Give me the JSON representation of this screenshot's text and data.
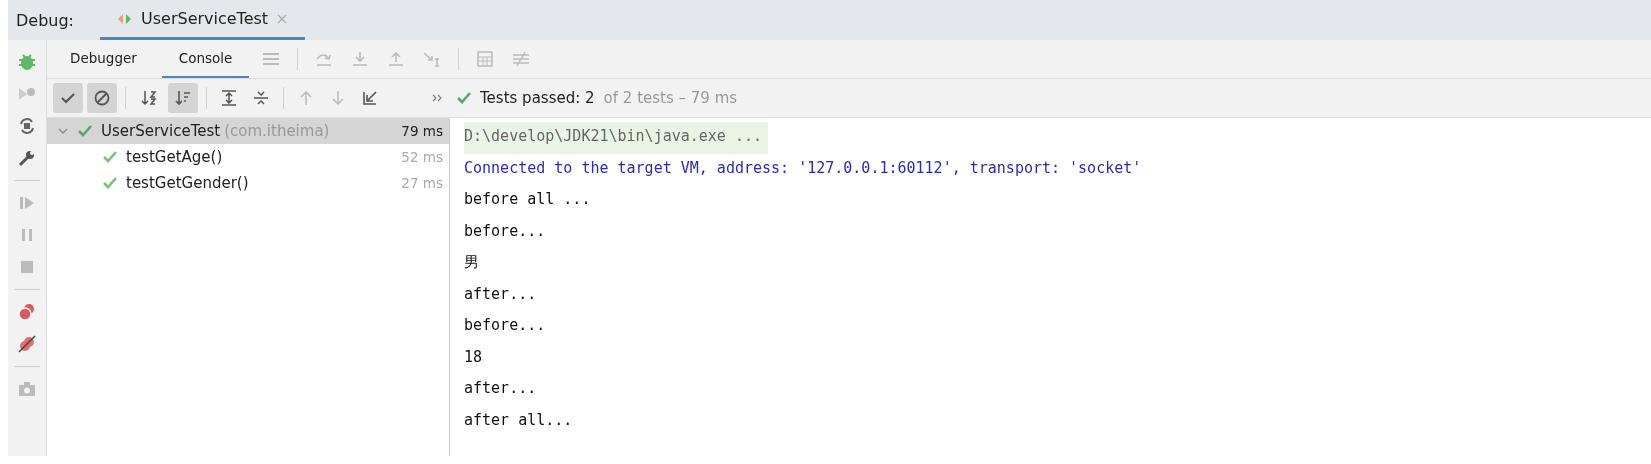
{
  "panel": {
    "title": "Debug:"
  },
  "session_tabs": [
    {
      "label": "UserServiceTest",
      "selected": true
    }
  ],
  "tabs": [
    {
      "label": "Debugger",
      "selected": false
    },
    {
      "label": "Console",
      "selected": true
    }
  ],
  "toolbar": {
    "toggles": [
      {
        "kind": "show-passed",
        "selected": true
      },
      {
        "kind": "show-ignored",
        "selected": true
      },
      {
        "kind": "sort-alpha",
        "selected": false
      },
      {
        "kind": "sort-duration",
        "selected": true
      }
    ]
  },
  "summary": {
    "label": "Tests passed: 2",
    "detail": "of 2 tests – 79 ms"
  },
  "tree": [
    {
      "name": "UserServiceTest",
      "package": "(com.itheima)",
      "time": "79 ms",
      "selected": true,
      "expanded": true,
      "children": [
        {
          "name": "testGetAge()",
          "time": "52 ms",
          "selected": false
        },
        {
          "name": "testGetGender()",
          "time": "27 ms",
          "selected": false
        }
      ]
    }
  ],
  "console": [
    {
      "kind": "command",
      "text": "D:\\develop\\JDK21\\bin\\java.exe ..."
    },
    {
      "kind": "info",
      "text": "Connected to the target VM, address: '127.0.0.1:60112', transport: 'socket'"
    },
    {
      "kind": "output",
      "text": "before all ..."
    },
    {
      "kind": "output",
      "text": "before..."
    },
    {
      "kind": "output",
      "text": "男"
    },
    {
      "kind": "output",
      "text": "after..."
    },
    {
      "kind": "output",
      "text": "before..."
    },
    {
      "kind": "output",
      "text": "18"
    },
    {
      "kind": "output",
      "text": "after..."
    },
    {
      "kind": "output",
      "text": "after all..."
    }
  ]
}
